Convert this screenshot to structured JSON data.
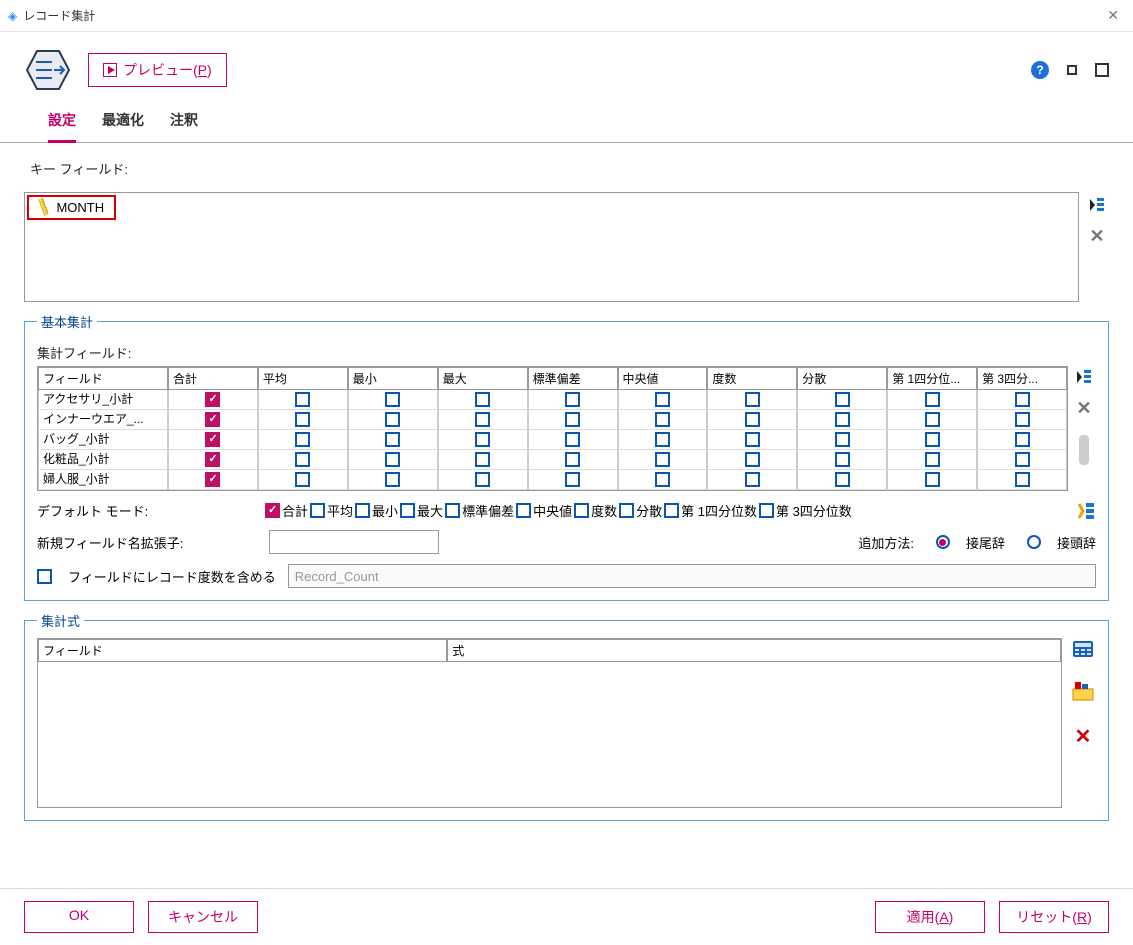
{
  "window": {
    "title": "レコード集計"
  },
  "toolbar": {
    "preview": "プレビュー(",
    "preview_key": "P",
    "preview_suffix": ")"
  },
  "tabs": {
    "settings": "設定",
    "optimize": "最適化",
    "annotate": "注釈"
  },
  "key_fields_label": "キー フィールド:",
  "key_field": "MONTH",
  "basic": {
    "legend": "基本集計",
    "agg_fields_label": "集計フィールド:",
    "columns": [
      "フィールド",
      "合計",
      "平均",
      "最小",
      "最大",
      "標準偏差",
      "中央値",
      "度数",
      "分散",
      "第 1四分位...",
      "第 3四分..."
    ],
    "rows": [
      {
        "name": "アクセサリ_小計",
        "sum": true
      },
      {
        "name": "インナーウエア_...",
        "sum": true
      },
      {
        "name": "バッグ_小計",
        "sum": true
      },
      {
        "name": "化粧品_小計",
        "sum": true
      },
      {
        "name": "婦人服_小計",
        "sum": true
      }
    ],
    "default_mode_label": "デフォルト モード:",
    "mode_items": [
      {
        "label": "合計",
        "on": true
      },
      {
        "label": "平均",
        "on": false
      },
      {
        "label": "最小",
        "on": false
      },
      {
        "label": "最大",
        "on": false
      },
      {
        "label": "標準偏差",
        "on": false
      },
      {
        "label": "中央値",
        "on": false
      },
      {
        "label": "度数",
        "on": false
      },
      {
        "label": "分散",
        "on": false
      },
      {
        "label": "第 1四分位数",
        "on": false
      },
      {
        "label": "第 3四分位数",
        "on": false
      }
    ],
    "ext_label": "新規フィールド名拡張子:",
    "ext_value": "",
    "add_method_label": "追加方法:",
    "radio_suffix": "接尾辞",
    "radio_prefix": "接頭辞",
    "include_count_label": "フィールドにレコード度数を含める",
    "count_placeholder": "Record_Count"
  },
  "expr": {
    "legend": "集計式",
    "col_field": "フィールド",
    "col_expr": "式"
  },
  "footer": {
    "ok": "OK",
    "cancel": "キャンセル",
    "apply": "適用(",
    "apply_key": "A",
    "apply_suffix": ")",
    "reset": "リセット(",
    "reset_key": "R",
    "reset_suffix": ")"
  }
}
